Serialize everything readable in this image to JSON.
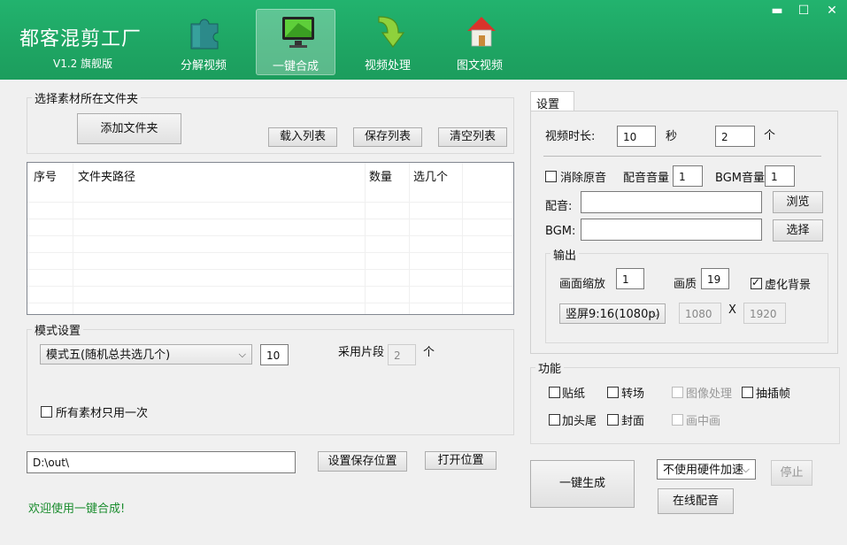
{
  "app": {
    "title": "都客混剪工厂",
    "version": "V1.2 旗舰版"
  },
  "nav": [
    {
      "label": "分解视频",
      "icon": "puzzle-icon"
    },
    {
      "label": "一键合成",
      "icon": "monitor-icon",
      "active": true
    },
    {
      "label": "视频处理",
      "icon": "down-arrow-icon"
    },
    {
      "label": "图文视频",
      "icon": "house-icon"
    }
  ],
  "window_controls": {
    "minimize": "▬",
    "maximize": "☐",
    "close": "✕"
  },
  "folder_group": {
    "title": "选择素材所在文件夹",
    "add_folder": "添加文件夹",
    "load_list": "载入列表",
    "save_list": "保存列表",
    "clear_list": "清空列表"
  },
  "table": {
    "columns": [
      "序号",
      "文件夹路径",
      "数量",
      "选几个"
    ],
    "rows": []
  },
  "mode_group": {
    "title": "模式设置",
    "mode_value": "模式五(随机总共选几个)",
    "count_value": "10",
    "segments_label": "采用片段",
    "segments_value": "2",
    "segments_unit": "个",
    "use_once_label": "所有素材只用一次"
  },
  "output_path": {
    "value": "D:\\out\\",
    "set_button": "设置保存位置",
    "open_button": "打开位置"
  },
  "status_text": "欢迎使用一键合成!",
  "settings": {
    "tab_label": "设置",
    "duration_label": "视频时长:",
    "duration_value": "10",
    "duration_unit": "秒",
    "count_value": "2",
    "count_unit": "个",
    "mute_label": "消除原音",
    "dub_volume_label": "配音音量",
    "dub_volume_value": "1",
    "bgm_volume_label": "BGM音量",
    "bgm_volume_value": "1",
    "dub_label": "配音:",
    "dub_value": "",
    "browse_button": "浏览",
    "bgm_label": "BGM:",
    "bgm_value": "",
    "select_button": "选择",
    "output_title": "输出",
    "scale_label": "画面缩放",
    "scale_value": "1",
    "quality_label": "画质",
    "quality_value": "19",
    "blur_bg_label": "虚化背景",
    "blur_bg_checked": true,
    "aspect_value": "竖屏9:16(1080p)",
    "width_value": "1080",
    "x_label": "X",
    "height_value": "1920"
  },
  "features": {
    "title": "功能",
    "sticker": "贴纸",
    "transition": "转场",
    "image_process": "图像处理",
    "frame_interp": "抽插帧",
    "head_tail": "加头尾",
    "cover": "封面",
    "pip": "画中画"
  },
  "actions": {
    "generate": "一键生成",
    "hw_accel": "不使用硬件加速",
    "stop": "停止",
    "online_dub": "在线配音"
  }
}
